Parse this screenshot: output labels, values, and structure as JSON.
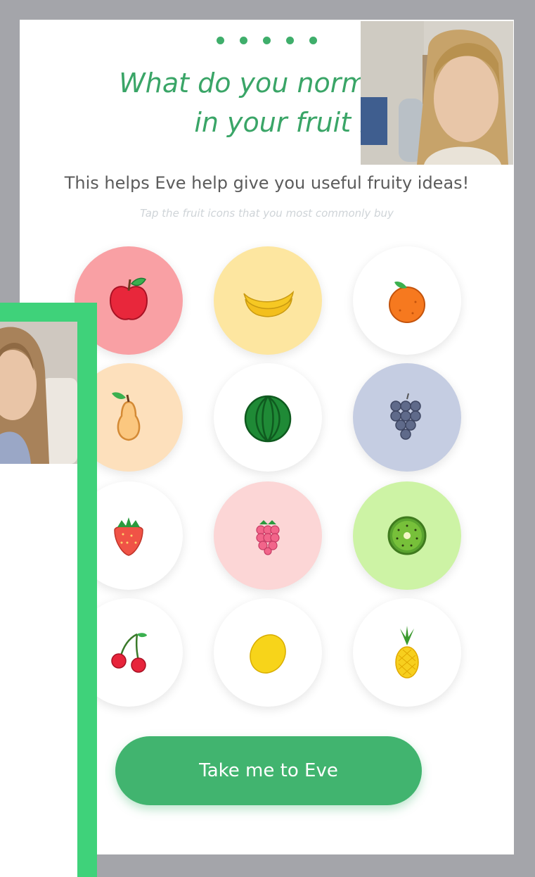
{
  "progress": {
    "total_steps": 5
  },
  "heading": {
    "line1": "What do you normall",
    "line2": "in your fruit bow"
  },
  "subtitle": "This helps Eve help give you useful fruity ideas!",
  "hint": "Tap the fruit icons that you most commonly buy",
  "fruits": [
    {
      "name": "apple",
      "selected": true,
      "bg": "#f9a0a4"
    },
    {
      "name": "banana",
      "selected": true,
      "bg": "#fde6a0"
    },
    {
      "name": "orange",
      "selected": false,
      "bg": "#ffffff"
    },
    {
      "name": "pear",
      "selected": true,
      "bg": "#fde0bc"
    },
    {
      "name": "watermelon",
      "selected": false,
      "bg": "#ffffff"
    },
    {
      "name": "grapes",
      "selected": true,
      "bg": "#c5cde2"
    },
    {
      "name": "strawberry",
      "selected": false,
      "bg": "#ffffff"
    },
    {
      "name": "raspberry",
      "selected": true,
      "bg": "#fcd6d6"
    },
    {
      "name": "kiwi",
      "selected": true,
      "bg": "#cdf3a5"
    },
    {
      "name": "cherries",
      "selected": false,
      "bg": "#ffffff"
    },
    {
      "name": "lemon",
      "selected": false,
      "bg": "#ffffff"
    },
    {
      "name": "pineapple",
      "selected": false,
      "bg": "#ffffff"
    }
  ],
  "cta": {
    "label": "Take me to Eve"
  },
  "colors": {
    "accent": "#41b46f",
    "heading": "#3aa567",
    "frame": "#3fd27a"
  }
}
